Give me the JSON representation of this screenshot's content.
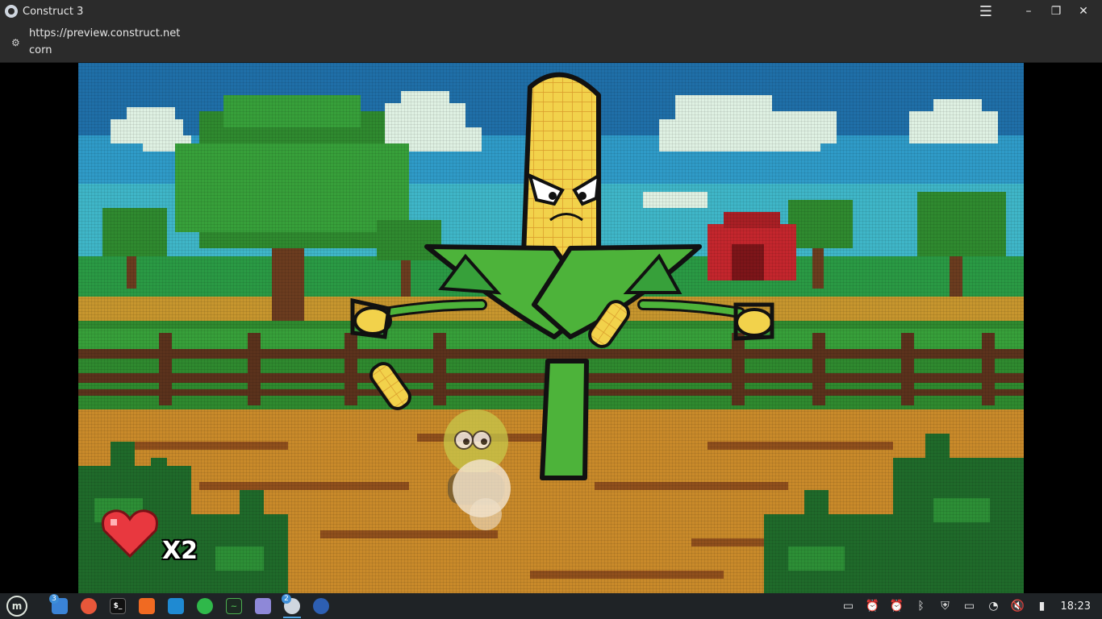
{
  "window": {
    "title": "Construct 3",
    "menu_icon": "hamburger-icon",
    "minimize_icon": "minimize-icon",
    "maximize_icon": "restore-icon",
    "close_icon": "close-icon"
  },
  "urlbar": {
    "url": "https://preview.construct.net",
    "page_title": "corn"
  },
  "game": {
    "lives_label": "X2",
    "colors": {
      "sky": "#2f9bc8",
      "grass": "#2f8a2f",
      "dirt": "#c98a2a",
      "corn_yellow": "#f2d24b",
      "leaf_green": "#4db33a",
      "heart": "#e8383f",
      "barn_red": "#c4262d"
    }
  },
  "taskbar": {
    "apps": [
      {
        "name": "linux-mint-menu",
        "icon": "mint-logo-icon",
        "badge": ""
      },
      {
        "name": "files",
        "icon": "folder-icon",
        "badge": "3"
      },
      {
        "name": "firefox",
        "icon": "firefox-icon",
        "badge": ""
      },
      {
        "name": "terminal",
        "icon": "terminal-icon",
        "badge": ""
      },
      {
        "name": "brave",
        "icon": "brave-icon",
        "badge": ""
      },
      {
        "name": "vscode",
        "icon": "vscode-icon",
        "badge": ""
      },
      {
        "name": "music",
        "icon": "headphones-icon",
        "badge": ""
      },
      {
        "name": "system-monitor",
        "icon": "monitor-icon",
        "badge": ""
      },
      {
        "name": "text-editor",
        "icon": "notes-icon",
        "badge": ""
      },
      {
        "name": "construct",
        "icon": "construct-icon",
        "badge": "2"
      },
      {
        "name": "emulator",
        "icon": "penguin-icon",
        "badge": ""
      }
    ],
    "clock": "18:23"
  }
}
